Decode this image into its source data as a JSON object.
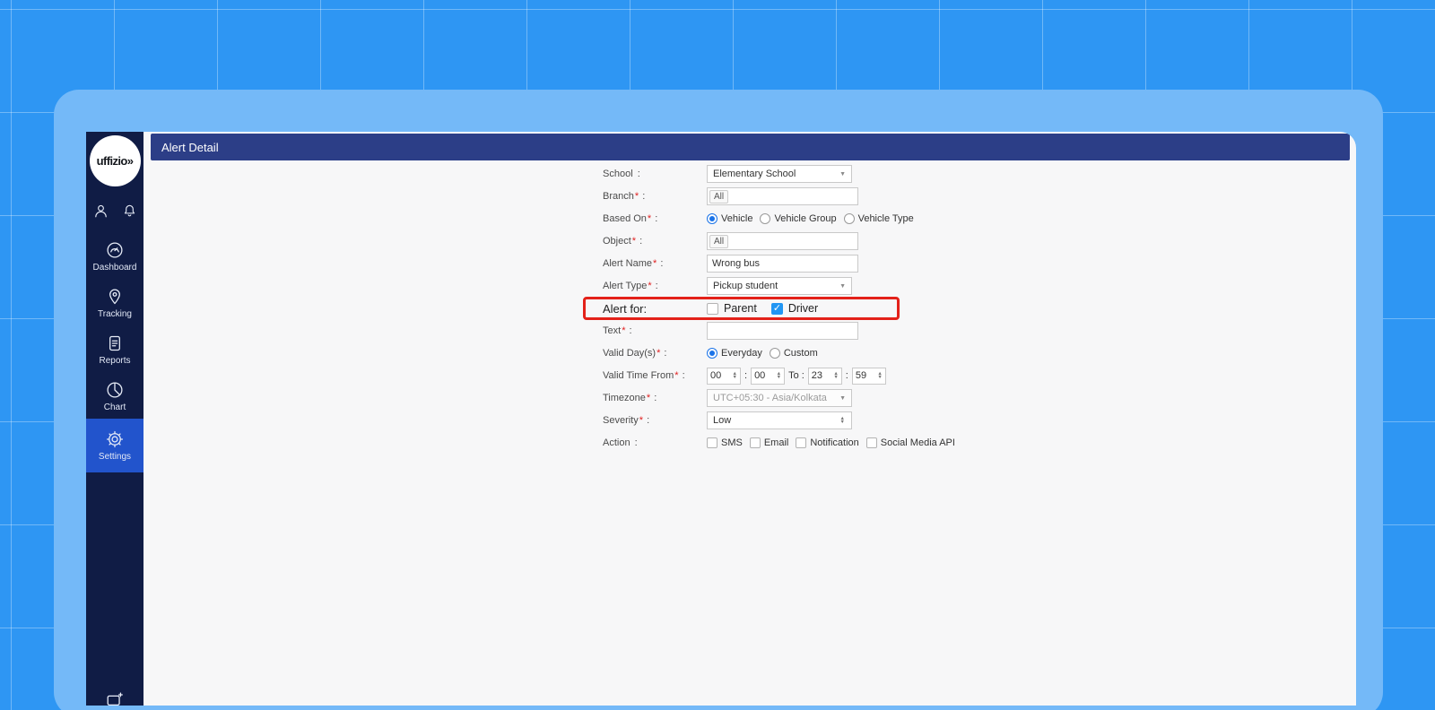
{
  "colors": {
    "background_blue": "#2e96f3",
    "window_frame_blue": "#74b9f8",
    "sidebar_navy": "#101c45",
    "sidebar_active_blue": "#2254cc",
    "header_bar_blue": "#2c3e87",
    "highlight_red": "#e32119",
    "checkbox_checked_blue": "#2196f3",
    "radio_selected_blue": "#1a73e8"
  },
  "sidebar": {
    "logo_text": "uffizio»",
    "top_icons": [
      "user-icon",
      "bell-icon"
    ],
    "items": [
      {
        "label": "Dashboard",
        "icon": "dashboard-icon",
        "active": false
      },
      {
        "label": "Tracking",
        "icon": "tracking-icon",
        "active": false
      },
      {
        "label": "Reports",
        "icon": "reports-icon",
        "active": false
      },
      {
        "label": "Chart",
        "icon": "chart-icon",
        "active": false
      },
      {
        "label": "Settings",
        "icon": "settings-icon",
        "active": true
      }
    ]
  },
  "header": {
    "title": "Alert Detail"
  },
  "form": {
    "rows": [
      {
        "name": "School",
        "req": "",
        "colon": " :",
        "type": "select",
        "value": "Elementary School"
      },
      {
        "name": "Branch",
        "req": "*",
        "colon": " :",
        "type": "chip-input",
        "chip": "All"
      },
      {
        "name": "Based On",
        "req": "*",
        "colon": " :",
        "type": "radio",
        "options": [
          {
            "label": "Vehicle",
            "selected": true
          },
          {
            "label": "Vehicle Group",
            "selected": false
          },
          {
            "label": "Vehicle Type",
            "selected": false
          }
        ]
      },
      {
        "name": "Object",
        "req": "*",
        "colon": " :",
        "type": "chip-input",
        "chip": "All"
      },
      {
        "name": "Alert Name",
        "req": "*",
        "colon": " :",
        "type": "text-input",
        "value": "Wrong bus"
      },
      {
        "name": "Alert Type",
        "req": "*",
        "colon": " :",
        "type": "select",
        "value": "Pickup student"
      },
      {
        "label": "Alert for:",
        "type": "checkbox",
        "highlighted": true,
        "options": [
          {
            "label": "Parent",
            "checked": false
          },
          {
            "label": "Driver",
            "checked": true
          }
        ]
      },
      {
        "name": "Text",
        "req": "*",
        "colon": " :",
        "type": "text-input",
        "value": ""
      },
      {
        "name": "Valid Day(s)",
        "req": "*",
        "colon": " :",
        "type": "radio",
        "options": [
          {
            "label": "Everyday",
            "selected": true
          },
          {
            "label": "Custom",
            "selected": false
          }
        ]
      },
      {
        "name": "Valid Time From",
        "req": "*",
        "colon": " :",
        "type": "time-range",
        "from_h": "00",
        "from_m": "00",
        "sep": ":",
        "to_label": "To :",
        "to_h": "23",
        "to_m": "59"
      },
      {
        "name": "Timezone",
        "req": "*",
        "colon": " :",
        "type": "select",
        "disabled": true,
        "value": "UTC+05:30 - Asia/Kolkata"
      },
      {
        "name": "Severity",
        "req": "*",
        "colon": " :",
        "type": "select-spinner",
        "value": "Low"
      },
      {
        "name": "Action",
        "req": "",
        "colon": " :",
        "type": "checkbox",
        "options": [
          {
            "label": "SMS",
            "checked": false
          },
          {
            "label": "Email",
            "checked": false
          },
          {
            "label": "Notification",
            "checked": false
          },
          {
            "label": "Social Media API",
            "checked": false
          }
        ]
      }
    ]
  }
}
